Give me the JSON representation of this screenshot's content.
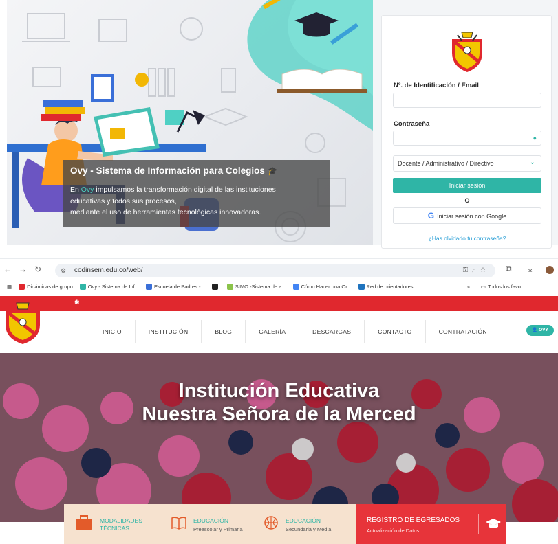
{
  "login_panel": {
    "caption_title": "Ovy - Sistema de Información para Colegios",
    "caption_lines": {
      "l1_prefix": "En ",
      "l1_highlight": "Ovy",
      "l1_rest": " impulsamos la transformación digital de las instituciones",
      "l2": "educativas y todos sus procesos,",
      "l3": "mediante el uso de herramientas tecnológicas innovadoras."
    },
    "id_label": "Nº. de Identificación / Email",
    "password_label": "Contraseña",
    "role_select": "Docente / Administrativo / Directivo",
    "login_button": "Iniciar sesión",
    "or_text": "O",
    "google_button": "Iniciar sesión con Google",
    "forgot_link": "¿Has olvidado tu contraseña?",
    "accent_color": "#2fb5a6"
  },
  "browser": {
    "url": "codinsem.edu.co/web/",
    "bookmarks": [
      {
        "label": "Dinámicas de grupo",
        "color": "#e0282e"
      },
      {
        "label": "Ovy - Sistema de Inf...",
        "color": "#2fb5a6"
      },
      {
        "label": "Escuela de Padres -...",
        "color": "#3a6fd8"
      },
      {
        "label": "",
        "color": "#222222"
      },
      {
        "label": "SIMO -Sistema de a...",
        "color": "#8bc34a"
      },
      {
        "label": "Cómo Hacer una Or...",
        "color": "#4285f4"
      },
      {
        "label": "Red de orientadores...",
        "color": "#1e73be"
      }
    ],
    "bookmarks_more": "»",
    "other_bookmarks": "Todos los favo"
  },
  "site": {
    "nav": [
      "INICIO",
      "INSTITUCIÓN",
      "BLOG",
      "GALERÍA",
      "DESCARGAS",
      "CONTACTO",
      "CONTRATACIÓN"
    ],
    "ovy_button": "OVY",
    "hero_line1": "Institución Educativa",
    "hero_line2": "Nuestra Señora de la Merced",
    "cards": [
      {
        "title1": "MODALIDADES",
        "title2": "TÉCNICAS"
      },
      {
        "title": "EDUCACIÓN",
        "subtitle": "Preescolar y Primaria"
      },
      {
        "title": "EDUCACIÓN",
        "subtitle": "Secundaria y Media"
      }
    ],
    "registro_title": "REGISTRO DE EGRESADOS",
    "registro_subtitle": "Actualización de Datos",
    "brand_red": "#e0282e"
  }
}
